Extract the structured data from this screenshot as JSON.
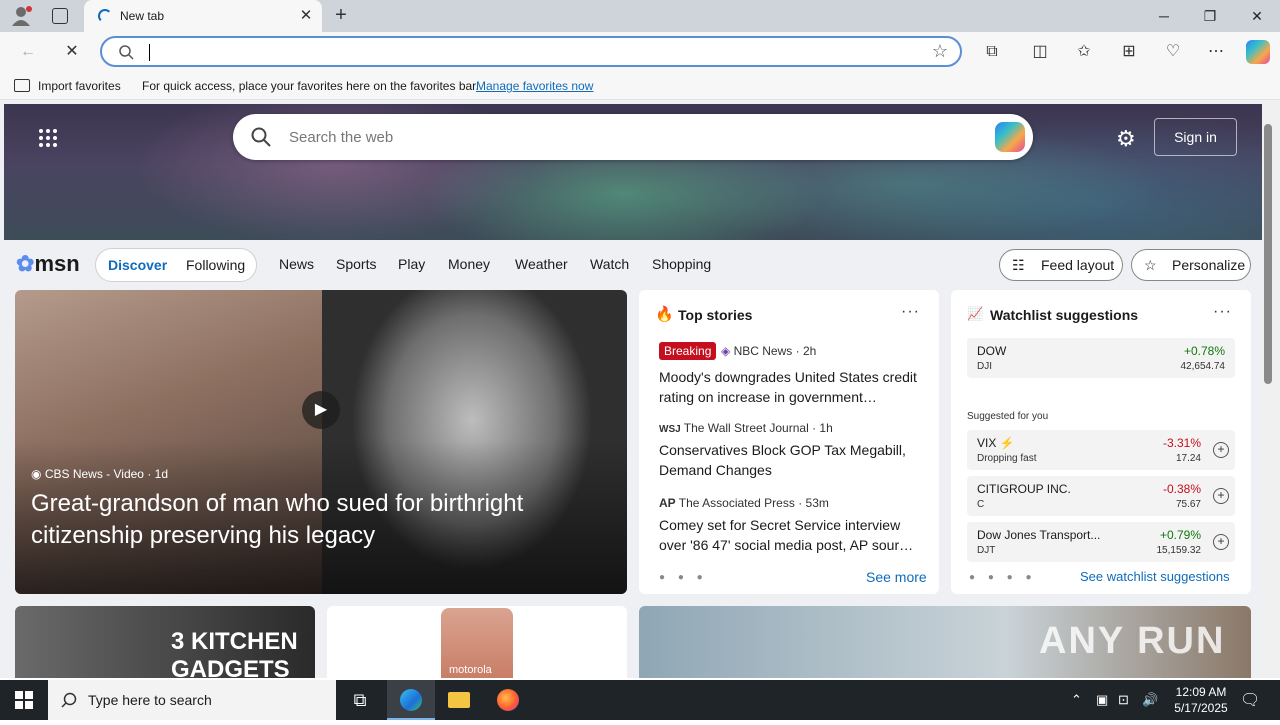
{
  "browser": {
    "tab_title": "New tab",
    "fav_import": "Import favorites",
    "fav_hint": "For quick access, place your favorites here on the favorites bar.",
    "fav_manage": "Manage favorites now"
  },
  "msn": {
    "search_placeholder": "Search the web",
    "signin": "Sign in",
    "logo": "msn",
    "tabs": [
      "Discover",
      "Following"
    ],
    "nav": [
      "News",
      "Sports",
      "Play",
      "Money",
      "Weather",
      "Watch",
      "Shopping"
    ],
    "feed_layout": "Feed layout",
    "personalize": "Personalize"
  },
  "feature": {
    "source": "CBS News - Video",
    "age": "1d",
    "title": "Great-grandson of man who sued for birthright citizenship preserving his legacy"
  },
  "top_stories": {
    "header": "Top stories",
    "items": [
      {
        "badge": "Breaking",
        "source": "NBC News",
        "age": "2h",
        "headline": "Moody's downgrades United States credit rating on increase in government…"
      },
      {
        "source": "The Wall Street Journal",
        "age": "1h",
        "headline": "Conservatives Block GOP Tax Megabill, Demand Changes"
      },
      {
        "source": "The Associated Press",
        "age": "53m",
        "headline": "Comey set for Secret Service interview over '86 47' social media post, AP sour…"
      }
    ],
    "see_more": "See more"
  },
  "watchlist": {
    "header": "Watchlist suggestions",
    "top": {
      "name": "DOW",
      "symbol": "DJI",
      "change": "+0.78%",
      "price": "42,654.74"
    },
    "suggested_label": "Suggested for you",
    "items": [
      {
        "name": "VIX",
        "symbol": "Dropping fast",
        "change": "-3.31%",
        "price": "17.24"
      },
      {
        "name": "CITIGROUP INC.",
        "symbol": "C",
        "change": "-0.38%",
        "price": "75.67"
      },
      {
        "name": "Dow Jones Transport...",
        "symbol": "DJT",
        "change": "+0.79%",
        "price": "15,159.32"
      }
    ],
    "see_all": "See watchlist suggestions"
  },
  "lower": {
    "kitchen": "3 KITCHEN GADGETS",
    "phone_brand": "motorola"
  },
  "watermark": "ANY RUN",
  "taskbar": {
    "search_placeholder": "Type here to search",
    "time": "12:09 AM",
    "date": "5/17/2025"
  }
}
